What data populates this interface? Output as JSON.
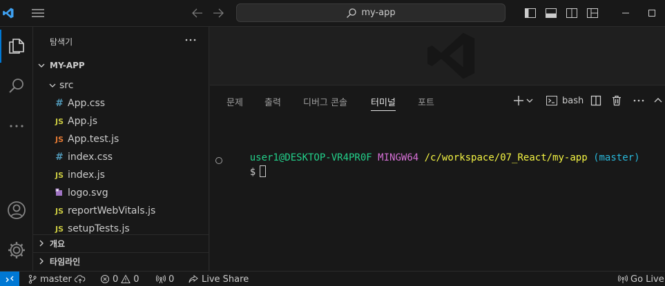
{
  "titlebar": {
    "search_text": "my-app"
  },
  "sidebar": {
    "title": "탐색기",
    "project": "MY-APP",
    "folder": "src",
    "files": [
      {
        "name": "App.css",
        "icon": "#",
        "kind": "css"
      },
      {
        "name": "App.js",
        "icon": "JS",
        "kind": "js"
      },
      {
        "name": "App.test.js",
        "icon": "JS",
        "kind": "test"
      },
      {
        "name": "index.css",
        "icon": "#",
        "kind": "css"
      },
      {
        "name": "index.js",
        "icon": "JS",
        "kind": "js"
      },
      {
        "name": "logo.svg",
        "icon": "svg-icon",
        "kind": "svg"
      },
      {
        "name": "reportWebVitals.js",
        "icon": "JS",
        "kind": "js"
      },
      {
        "name": "setupTests.js",
        "icon": "JS",
        "kind": "js"
      }
    ],
    "outline": "개요",
    "timeline": "타임라인"
  },
  "panel": {
    "tabs": [
      "문제",
      "출력",
      "디버그 콘솔",
      "터미널",
      "포트"
    ],
    "active_tab": "터미널",
    "terminal_name": "bash",
    "prompt": {
      "user": "user1@DESKTOP-VR4PR0F",
      "env": "MINGW64",
      "path": "/c/workspace/07_React/my-app",
      "branch": "(master)",
      "symbol": "$"
    }
  },
  "statusbar": {
    "branch": "master",
    "errors": "0",
    "warnings": "0",
    "ports": "0",
    "live_share": "Live Share",
    "go_live": "Go Live"
  },
  "colors": {
    "accent": "#0078d4",
    "terminal_user": "#23d18b",
    "terminal_env": "#d670d6",
    "terminal_path": "#f5f543",
    "terminal_branch": "#29b8db"
  }
}
